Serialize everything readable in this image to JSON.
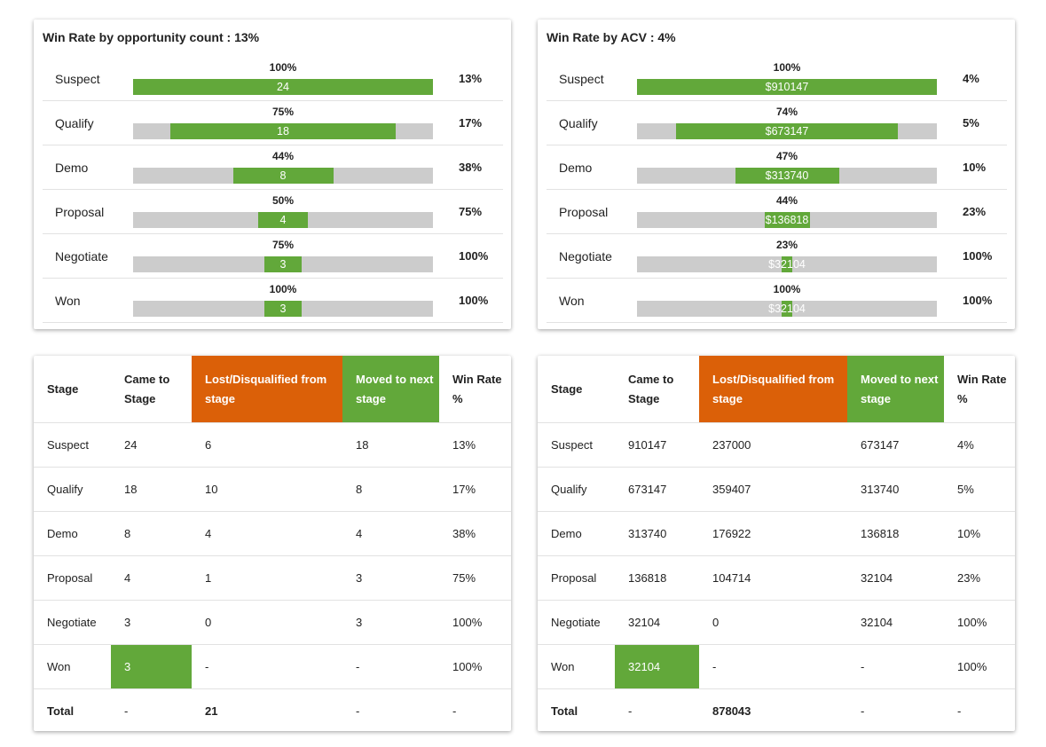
{
  "colors": {
    "accent_green": "#62a83a",
    "lost_orange": "#db6008",
    "track_gray": "#cccccc"
  },
  "funnel_count": {
    "title": "Win Rate by opportunity count : 13%",
    "rows": [
      {
        "stage": "Suspect",
        "pct": "100%",
        "value": "24",
        "rate": "13%",
        "fill_fraction": 1.0
      },
      {
        "stage": "Qualify",
        "pct": "75%",
        "value": "18",
        "rate": "17%",
        "fill_fraction": 0.75
      },
      {
        "stage": "Demo",
        "pct": "44%",
        "value": "8",
        "rate": "38%",
        "fill_fraction": 0.333
      },
      {
        "stage": "Proposal",
        "pct": "50%",
        "value": "4",
        "rate": "75%",
        "fill_fraction": 0.1667
      },
      {
        "stage": "Negotiate",
        "pct": "75%",
        "value": "3",
        "rate": "100%",
        "fill_fraction": 0.125
      },
      {
        "stage": "Won",
        "pct": "100%",
        "value": "3",
        "rate": "100%",
        "fill_fraction": 0.125
      }
    ]
  },
  "funnel_acv": {
    "title": "Win Rate by ACV : 4%",
    "rows": [
      {
        "stage": "Suspect",
        "pct": "100%",
        "value": "$910147",
        "rate": "4%",
        "fill_fraction": 1.0
      },
      {
        "stage": "Qualify",
        "pct": "74%",
        "value": "$673147",
        "rate": "5%",
        "fill_fraction": 0.7396
      },
      {
        "stage": "Demo",
        "pct": "47%",
        "value": "$313740",
        "rate": "10%",
        "fill_fraction": 0.3447
      },
      {
        "stage": "Proposal",
        "pct": "44%",
        "value": "$136818",
        "rate": "23%",
        "fill_fraction": 0.1503
      },
      {
        "stage": "Negotiate",
        "pct": "23%",
        "value": "$32104",
        "rate": "100%",
        "fill_fraction": 0.0353
      },
      {
        "stage": "Won",
        "pct": "100%",
        "value": "$32104",
        "rate": "100%",
        "fill_fraction": 0.0353
      }
    ]
  },
  "table_count": {
    "headers": [
      "Stage",
      "Came to Stage",
      "Lost/Disqualified from stage",
      "Moved to next stage",
      "Win Rate %"
    ],
    "rows": [
      [
        "Suspect",
        "24",
        "6",
        "18",
        "13%"
      ],
      [
        "Qualify",
        "18",
        "10",
        "8",
        "17%"
      ],
      [
        "Demo",
        "8",
        "4",
        "4",
        "38%"
      ],
      [
        "Proposal",
        "4",
        "1",
        "3",
        "75%"
      ],
      [
        "Negotiate",
        "3",
        "0",
        "3",
        "100%"
      ],
      [
        "Won",
        "3",
        "-",
        "-",
        "100%"
      ],
      [
        "Total",
        "-",
        "21",
        "-",
        "-"
      ]
    ]
  },
  "table_acv": {
    "headers": [
      "Stage",
      "Came to Stage",
      "Lost/Disqualified from stage",
      "Moved to next stage",
      "Win Rate %"
    ],
    "rows": [
      [
        "Suspect",
        "910147",
        "237000",
        "673147",
        "4%"
      ],
      [
        "Qualify",
        "673147",
        "359407",
        "313740",
        "5%"
      ],
      [
        "Demo",
        "313740",
        "176922",
        "136818",
        "10%"
      ],
      [
        "Proposal",
        "136818",
        "104714",
        "32104",
        "23%"
      ],
      [
        "Negotiate",
        "32104",
        "0",
        "32104",
        "100%"
      ],
      [
        "Won",
        "32104",
        "-",
        "-",
        "100%"
      ],
      [
        "Total",
        "-",
        "878043",
        "-",
        "-"
      ]
    ]
  }
}
